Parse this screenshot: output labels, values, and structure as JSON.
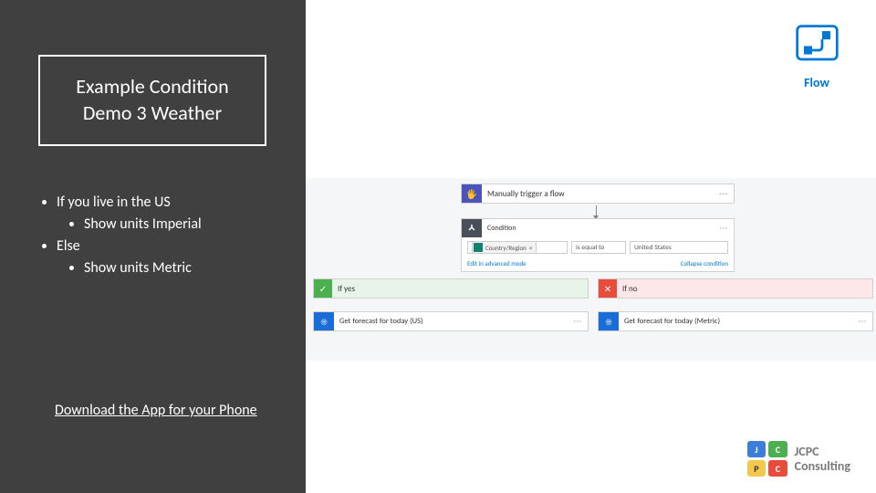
{
  "title": "Example Condition Demo 3 Weather",
  "bullets": {
    "b1": "If you live in the US",
    "b1a": "Show units Imperial",
    "b2": "Else",
    "b2a": "Show units Metric"
  },
  "download_link": "Download the App for your Phone",
  "flow_logo_label": "Flow",
  "flow": {
    "trigger": {
      "label": "Manually trigger a flow",
      "menu": "···"
    },
    "condition": {
      "title": "Condition",
      "token": "Country/Region",
      "token_x": "×",
      "operator": "is equal to",
      "value": "United States",
      "edit_link": "Edit in advanced mode",
      "collapse_link": "Collapse condition",
      "menu": "···"
    },
    "yes": {
      "header": "If yes",
      "check": "✓",
      "action": "Get forecast for today (US)",
      "menu": "···"
    },
    "no": {
      "header": "If no",
      "x": "✕",
      "action": "Get forecast for today (Metric)",
      "menu": "···"
    },
    "weather_icon": "☀"
  },
  "jcpc": {
    "j": "J",
    "c1": "C",
    "p": "P",
    "c2": "C",
    "line1": "JCPC",
    "line2": "Consulting"
  },
  "hand_icon": "🖐"
}
